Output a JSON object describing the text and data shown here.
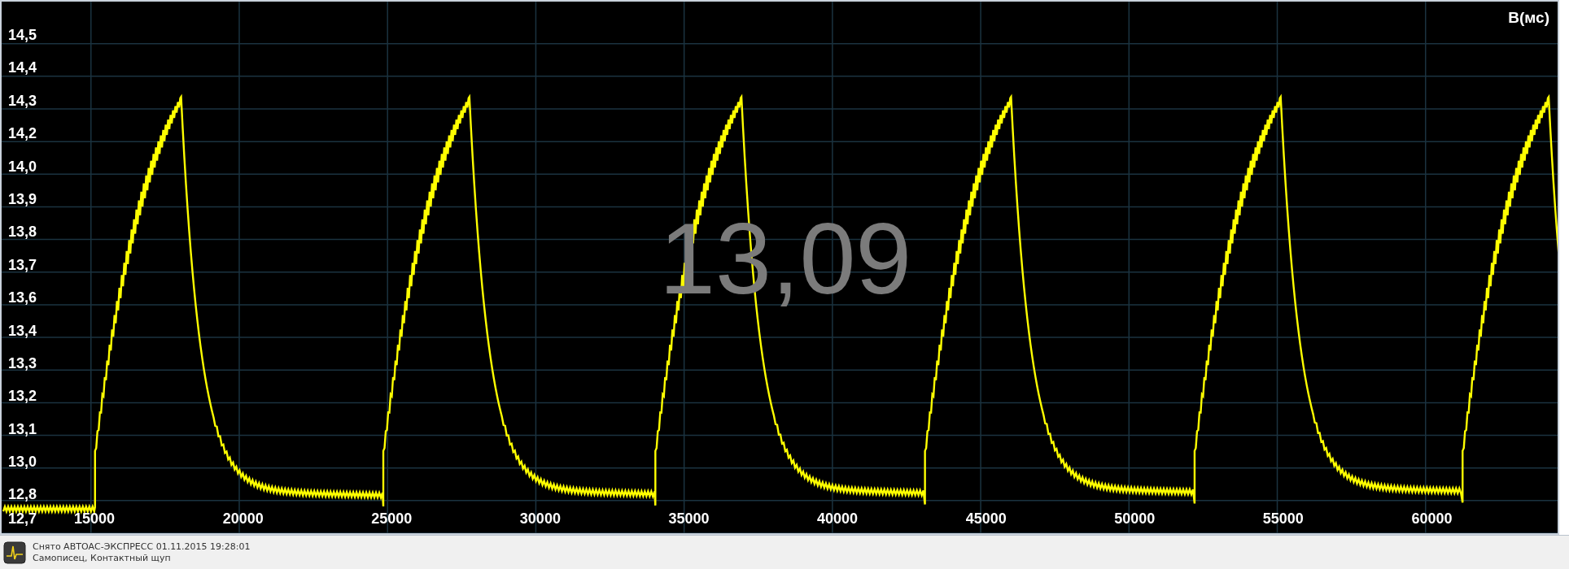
{
  "plot": {
    "unit_label": "В(мс)",
    "reading": "13,09",
    "y_labels": [
      "14,5",
      "14,4",
      "14,3",
      "14,2",
      "14,0",
      "13,9",
      "13,8",
      "13,7",
      "13,6",
      "13,4",
      "13,3",
      "13,2",
      "13,1",
      "13,0",
      "12,8"
    ],
    "corner_label": "12,7",
    "x_labels": [
      "15000",
      "20000",
      "25000",
      "30000",
      "35000",
      "40000",
      "45000",
      "50000",
      "55000",
      "60000"
    ]
  },
  "status_bar": {
    "lines": [
      "Снято АВТОАС-ЭКСПРЕСС 01.11.2015 19:28:01",
      "Самописец, Контактный щуп"
    ]
  }
}
